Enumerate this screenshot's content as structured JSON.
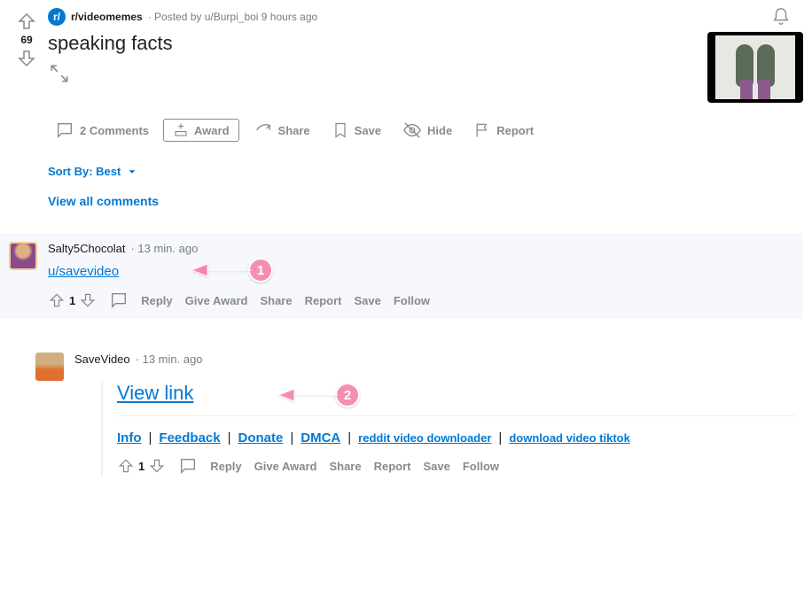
{
  "post": {
    "subreddit_icon": "r/",
    "subreddit": "r/videomemes",
    "posted_by": "· Posted by u/Burpi_boi 9 hours ago",
    "score": "69",
    "title": "speaking facts",
    "actions": {
      "comments": "2 Comments",
      "award": "Award",
      "share": "Share",
      "save": "Save",
      "hide": "Hide",
      "report": "Report"
    }
  },
  "sort": {
    "label": "Sort By: Best"
  },
  "view_all": "View all comments",
  "comment1": {
    "author": "Salty5Chocolat",
    "time": "· 13 min. ago",
    "body_link": "u/savevideo",
    "score": "1",
    "actions": {
      "reply": "Reply",
      "award": "Give Award",
      "share": "Share",
      "report": "Report",
      "save": "Save",
      "follow": "Follow"
    }
  },
  "comment2": {
    "author": "SaveVideo",
    "time": "· 13 min. ago",
    "view_link": "View link",
    "links": {
      "info": "Info",
      "feedback": "Feedback",
      "donate": "Donate",
      "dmca": "DMCA",
      "rvd": "reddit video downloader",
      "dvt": "download video tiktok"
    },
    "score": "1",
    "actions": {
      "reply": "Reply",
      "award": "Give Award",
      "share": "Share",
      "report": "Report",
      "save": "Save",
      "follow": "Follow"
    }
  },
  "annotations": {
    "n1": "1",
    "n2": "2"
  }
}
